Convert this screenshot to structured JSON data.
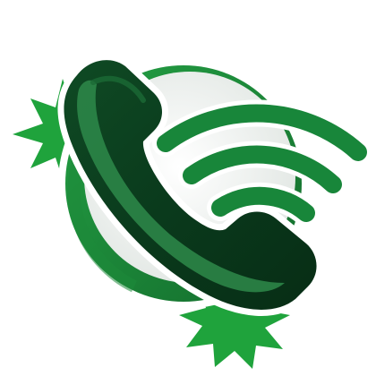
{
  "graphic": {
    "kind": "icon",
    "name": "phone-call-icon",
    "elements": [
      "starburst-icon",
      "globe-circle-icon",
      "phone-handset-icon",
      "signal-waves-icon"
    ]
  },
  "colors": {
    "background": "#ffffff",
    "starburst": "#1fa33c",
    "circle_ring": "#1d8a3a",
    "circle_fill": "#eef1ef",
    "handset_dark": "#0a3a1c",
    "handset_mid": "#135a2b",
    "handset_highlight": "#2e8a4a",
    "waves": "#18863a",
    "outline": "#ffffff"
  }
}
